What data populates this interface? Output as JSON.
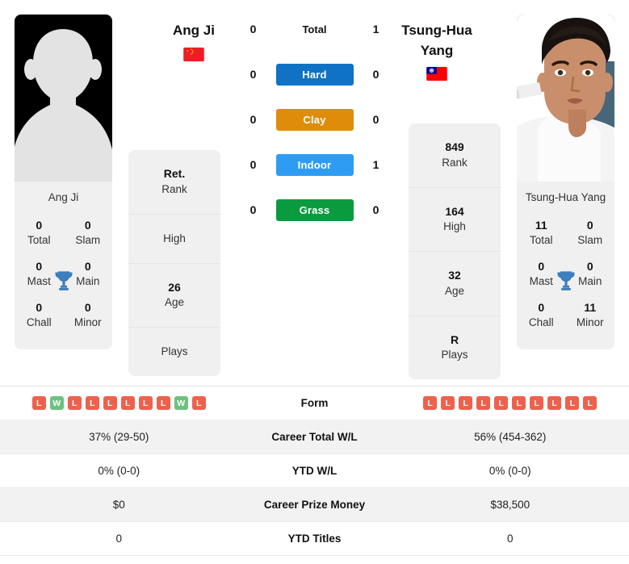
{
  "players": {
    "left": {
      "name": "Ang Ji",
      "photo_caption": "Ang Ji",
      "flag": "cn-flag-icon",
      "photo": "placeholder-silhouette-photo",
      "info": [
        {
          "value": "Ret.",
          "label": "Rank"
        },
        {
          "value": "",
          "label": "High"
        },
        {
          "value": "26",
          "label": "Age"
        },
        {
          "value": "",
          "label": "Plays"
        }
      ],
      "titles": [
        {
          "value": "0",
          "label": "Total"
        },
        {
          "value": "0",
          "label": "Slam"
        },
        {
          "value": "0",
          "label": "Mast"
        },
        {
          "value": "0",
          "label": "Main"
        },
        {
          "value": "0",
          "label": "Chall"
        },
        {
          "value": "0",
          "label": "Minor"
        }
      ],
      "form": [
        "L",
        "W",
        "L",
        "L",
        "L",
        "L",
        "L",
        "L",
        "W",
        "L"
      ],
      "career_total_wl": "37% (29-50)",
      "ytd_wl": "0% (0-0)",
      "career_prize_money": "$0",
      "ytd_titles": "0"
    },
    "right": {
      "name": "Tsung-Hua Yang",
      "photo_caption": "Tsung-Hua Yang",
      "flag": "tw-flag-icon",
      "photo": "player-portrait-photo",
      "info": [
        {
          "value": "849",
          "label": "Rank"
        },
        {
          "value": "164",
          "label": "High"
        },
        {
          "value": "32",
          "label": "Age"
        },
        {
          "value": "R",
          "label": "Plays"
        }
      ],
      "titles": [
        {
          "value": "11",
          "label": "Total"
        },
        {
          "value": "0",
          "label": "Slam"
        },
        {
          "value": "0",
          "label": "Mast"
        },
        {
          "value": "0",
          "label": "Main"
        },
        {
          "value": "0",
          "label": "Chall"
        },
        {
          "value": "11",
          "label": "Minor"
        }
      ],
      "form": [
        "L",
        "L",
        "L",
        "L",
        "L",
        "L",
        "L",
        "L",
        "L",
        "L"
      ],
      "career_total_wl": "56% (454-362)",
      "ytd_wl": "0% (0-0)",
      "career_prize_money": "$38,500",
      "ytd_titles": "0"
    }
  },
  "head_to_head": [
    {
      "label": "Total",
      "left": "0",
      "right": "1",
      "badge": false,
      "color": ""
    },
    {
      "label": "Hard",
      "left": "0",
      "right": "0",
      "badge": true,
      "color": "#0f72c4"
    },
    {
      "label": "Clay",
      "left": "0",
      "right": "0",
      "badge": true,
      "color": "#de8c0a"
    },
    {
      "label": "Indoor",
      "left": "0",
      "right": "1",
      "badge": true,
      "color": "#2f9cf4"
    },
    {
      "label": "Grass",
      "left": "0",
      "right": "0",
      "badge": true,
      "color": "#0a9b3f"
    }
  ],
  "table_rows": [
    {
      "label": "Form",
      "type": "form"
    },
    {
      "label": "Career Total W/L",
      "type": "text",
      "left": "37% (29-50)",
      "right": "56% (454-362)"
    },
    {
      "label": "YTD W/L",
      "type": "text",
      "left": "0% (0-0)",
      "right": "0% (0-0)"
    },
    {
      "label": "Career Prize Money",
      "type": "text",
      "left": "$0",
      "right": "$38,500"
    },
    {
      "label": "YTD Titles",
      "type": "text",
      "left": "0",
      "right": "0"
    }
  ],
  "colors": {
    "win_badge": "#6ec17f",
    "loss_badge": "#f0604d",
    "trophy": "#3d7ebd",
    "card_bg": "#f0f0f0",
    "row_alt_bg": "#f2f2f2"
  }
}
